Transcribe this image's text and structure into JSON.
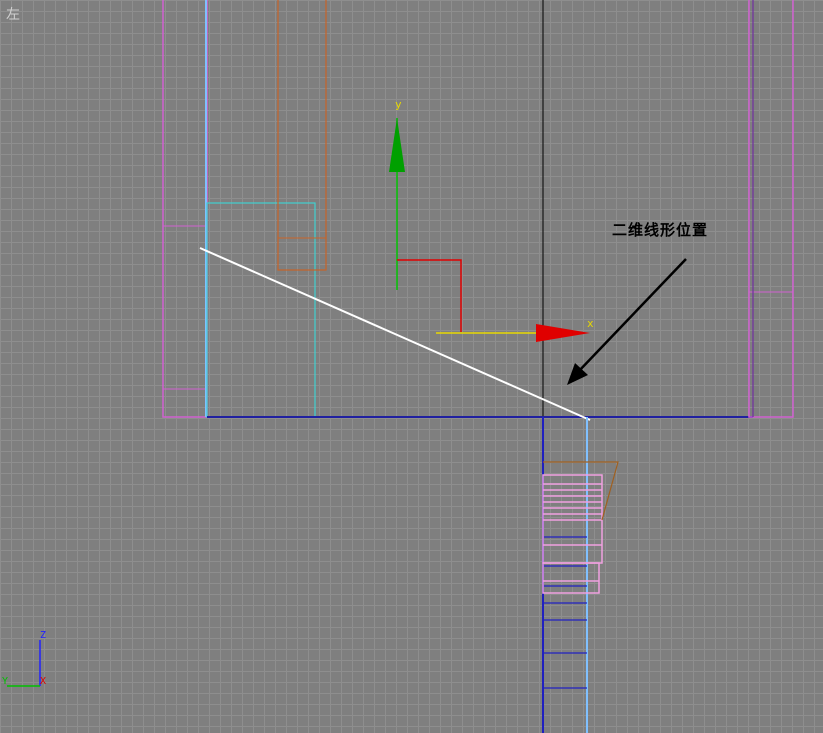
{
  "viewport": {
    "label": "左"
  },
  "annotation": {
    "text": "二维线形位置"
  },
  "gizmo": {
    "x_label": "x",
    "y_label": "y",
    "x_color": "#e8d800",
    "y_color": "#00c000",
    "arrow_x_color": "#e00000",
    "arrow_y_color": "#00a000"
  },
  "axis_tripod": {
    "z_label": "Z",
    "y_label": "Y",
    "x_label": "X"
  },
  "colors": {
    "grid_major": "#8e8e8e",
    "background": "#7f7f7f",
    "selected_line": "#ffffff"
  }
}
